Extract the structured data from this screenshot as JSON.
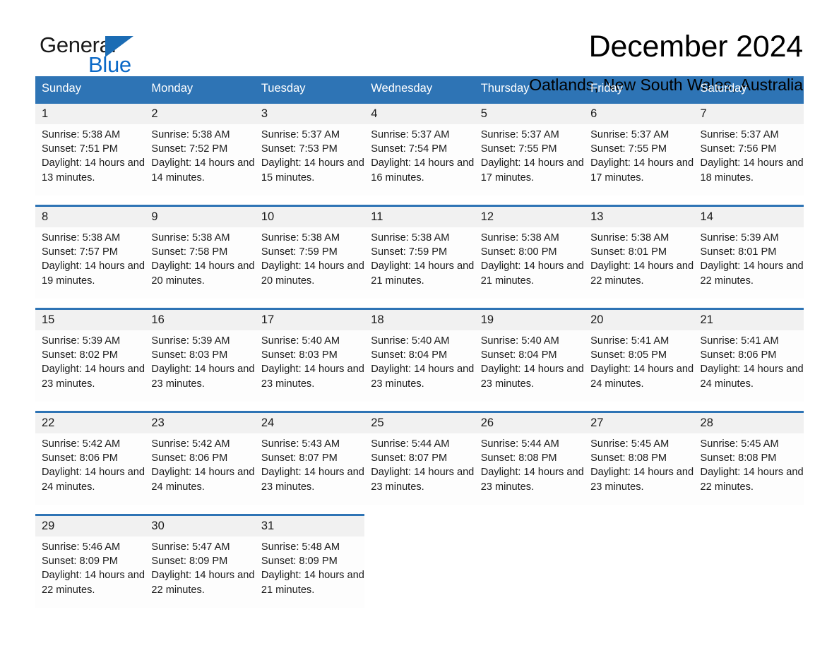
{
  "logo": {
    "word_dark": "General",
    "word_blue": "Blue",
    "triangle_icon": "triangle-icon"
  },
  "header": {
    "title": "December 2024",
    "location": "Oatlands, New South Wales, Australia"
  },
  "colors": {
    "header_blue": "#2e74b5",
    "logo_blue": "#0b69c7",
    "daynum_bg": "#f1f1f1",
    "cell_bg": "#fdfdfd"
  },
  "calendar": {
    "weekday_headers": [
      "Sunday",
      "Monday",
      "Tuesday",
      "Wednesday",
      "Thursday",
      "Friday",
      "Saturday"
    ],
    "weeks": [
      [
        {
          "day": "1",
          "sunrise": "Sunrise: 5:38 AM",
          "sunset": "Sunset: 7:51 PM",
          "daylight": "Daylight: 14 hours and 13 minutes."
        },
        {
          "day": "2",
          "sunrise": "Sunrise: 5:38 AM",
          "sunset": "Sunset: 7:52 PM",
          "daylight": "Daylight: 14 hours and 14 minutes."
        },
        {
          "day": "3",
          "sunrise": "Sunrise: 5:37 AM",
          "sunset": "Sunset: 7:53 PM",
          "daylight": "Daylight: 14 hours and 15 minutes."
        },
        {
          "day": "4",
          "sunrise": "Sunrise: 5:37 AM",
          "sunset": "Sunset: 7:54 PM",
          "daylight": "Daylight: 14 hours and 16 minutes."
        },
        {
          "day": "5",
          "sunrise": "Sunrise: 5:37 AM",
          "sunset": "Sunset: 7:55 PM",
          "daylight": "Daylight: 14 hours and 17 minutes."
        },
        {
          "day": "6",
          "sunrise": "Sunrise: 5:37 AM",
          "sunset": "Sunset: 7:55 PM",
          "daylight": "Daylight: 14 hours and 17 minutes."
        },
        {
          "day": "7",
          "sunrise": "Sunrise: 5:37 AM",
          "sunset": "Sunset: 7:56 PM",
          "daylight": "Daylight: 14 hours and 18 minutes."
        }
      ],
      [
        {
          "day": "8",
          "sunrise": "Sunrise: 5:38 AM",
          "sunset": "Sunset: 7:57 PM",
          "daylight": "Daylight: 14 hours and 19 minutes."
        },
        {
          "day": "9",
          "sunrise": "Sunrise: 5:38 AM",
          "sunset": "Sunset: 7:58 PM",
          "daylight": "Daylight: 14 hours and 20 minutes."
        },
        {
          "day": "10",
          "sunrise": "Sunrise: 5:38 AM",
          "sunset": "Sunset: 7:59 PM",
          "daylight": "Daylight: 14 hours and 20 minutes."
        },
        {
          "day": "11",
          "sunrise": "Sunrise: 5:38 AM",
          "sunset": "Sunset: 7:59 PM",
          "daylight": "Daylight: 14 hours and 21 minutes."
        },
        {
          "day": "12",
          "sunrise": "Sunrise: 5:38 AM",
          "sunset": "Sunset: 8:00 PM",
          "daylight": "Daylight: 14 hours and 21 minutes."
        },
        {
          "day": "13",
          "sunrise": "Sunrise: 5:38 AM",
          "sunset": "Sunset: 8:01 PM",
          "daylight": "Daylight: 14 hours and 22 minutes."
        },
        {
          "day": "14",
          "sunrise": "Sunrise: 5:39 AM",
          "sunset": "Sunset: 8:01 PM",
          "daylight": "Daylight: 14 hours and 22 minutes."
        }
      ],
      [
        {
          "day": "15",
          "sunrise": "Sunrise: 5:39 AM",
          "sunset": "Sunset: 8:02 PM",
          "daylight": "Daylight: 14 hours and 23 minutes."
        },
        {
          "day": "16",
          "sunrise": "Sunrise: 5:39 AM",
          "sunset": "Sunset: 8:03 PM",
          "daylight": "Daylight: 14 hours and 23 minutes."
        },
        {
          "day": "17",
          "sunrise": "Sunrise: 5:40 AM",
          "sunset": "Sunset: 8:03 PM",
          "daylight": "Daylight: 14 hours and 23 minutes."
        },
        {
          "day": "18",
          "sunrise": "Sunrise: 5:40 AM",
          "sunset": "Sunset: 8:04 PM",
          "daylight": "Daylight: 14 hours and 23 minutes."
        },
        {
          "day": "19",
          "sunrise": "Sunrise: 5:40 AM",
          "sunset": "Sunset: 8:04 PM",
          "daylight": "Daylight: 14 hours and 23 minutes."
        },
        {
          "day": "20",
          "sunrise": "Sunrise: 5:41 AM",
          "sunset": "Sunset: 8:05 PM",
          "daylight": "Daylight: 14 hours and 24 minutes."
        },
        {
          "day": "21",
          "sunrise": "Sunrise: 5:41 AM",
          "sunset": "Sunset: 8:06 PM",
          "daylight": "Daylight: 14 hours and 24 minutes."
        }
      ],
      [
        {
          "day": "22",
          "sunrise": "Sunrise: 5:42 AM",
          "sunset": "Sunset: 8:06 PM",
          "daylight": "Daylight: 14 hours and 24 minutes."
        },
        {
          "day": "23",
          "sunrise": "Sunrise: 5:42 AM",
          "sunset": "Sunset: 8:06 PM",
          "daylight": "Daylight: 14 hours and 24 minutes."
        },
        {
          "day": "24",
          "sunrise": "Sunrise: 5:43 AM",
          "sunset": "Sunset: 8:07 PM",
          "daylight": "Daylight: 14 hours and 23 minutes."
        },
        {
          "day": "25",
          "sunrise": "Sunrise: 5:44 AM",
          "sunset": "Sunset: 8:07 PM",
          "daylight": "Daylight: 14 hours and 23 minutes."
        },
        {
          "day": "26",
          "sunrise": "Sunrise: 5:44 AM",
          "sunset": "Sunset: 8:08 PM",
          "daylight": "Daylight: 14 hours and 23 minutes."
        },
        {
          "day": "27",
          "sunrise": "Sunrise: 5:45 AM",
          "sunset": "Sunset: 8:08 PM",
          "daylight": "Daylight: 14 hours and 23 minutes."
        },
        {
          "day": "28",
          "sunrise": "Sunrise: 5:45 AM",
          "sunset": "Sunset: 8:08 PM",
          "daylight": "Daylight: 14 hours and 22 minutes."
        }
      ],
      [
        {
          "day": "29",
          "sunrise": "Sunrise: 5:46 AM",
          "sunset": "Sunset: 8:09 PM",
          "daylight": "Daylight: 14 hours and 22 minutes."
        },
        {
          "day": "30",
          "sunrise": "Sunrise: 5:47 AM",
          "sunset": "Sunset: 8:09 PM",
          "daylight": "Daylight: 14 hours and 22 minutes."
        },
        {
          "day": "31",
          "sunrise": "Sunrise: 5:48 AM",
          "sunset": "Sunset: 8:09 PM",
          "daylight": "Daylight: 14 hours and 21 minutes."
        },
        {
          "day": "",
          "sunrise": "",
          "sunset": "",
          "daylight": ""
        },
        {
          "day": "",
          "sunrise": "",
          "sunset": "",
          "daylight": ""
        },
        {
          "day": "",
          "sunrise": "",
          "sunset": "",
          "daylight": ""
        },
        {
          "day": "",
          "sunrise": "",
          "sunset": "",
          "daylight": ""
        }
      ]
    ]
  }
}
